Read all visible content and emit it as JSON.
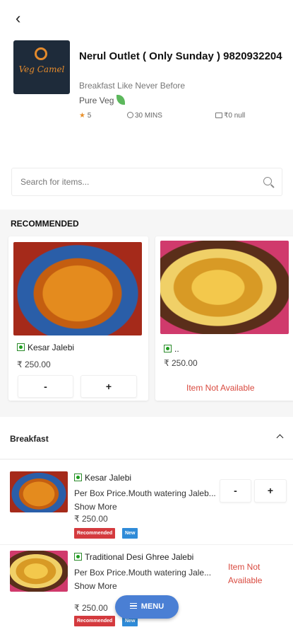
{
  "header": {
    "back_icon": "back-arrow-icon"
  },
  "shop": {
    "logo_text": "Veg Camel",
    "title": "Nerul Outlet ( Only Sunday ) 9820932204",
    "tagline": "Breakfast Like Never Before",
    "pure_veg": "Pure Veg",
    "rating": "5",
    "time": "30 MINS",
    "cost": "₹0 null"
  },
  "search": {
    "placeholder": "Search for items..."
  },
  "recommended": {
    "title": "RECOMMENDED",
    "cards": [
      {
        "name": "Kesar Jalebi",
        "price": "₹ 250.00",
        "minus": "-",
        "plus": "+"
      },
      {
        "name": "..",
        "price": "₹ 250.00",
        "status": "Item Not Available"
      }
    ]
  },
  "section": {
    "title": "Breakfast"
  },
  "items": [
    {
      "name": "Kesar Jalebi",
      "desc": "Per Box Price.Mouth watering Jaleb...",
      "more": "Show More",
      "price": "₹ 250.00",
      "badge_recommended": "Recommended",
      "badge_new": "New",
      "minus": "-",
      "plus": "+"
    },
    {
      "name": "Traditional Desi Ghree Jalebi",
      "desc": "Per Box Price.Mouth watering Jale...",
      "more": "Show More",
      "price": "₹ 250.00",
      "badge_recommended": "Recommended",
      "badge_new": "New",
      "status": "Item Not Available"
    }
  ],
  "fab": {
    "label": "MENU"
  },
  "colors": {
    "accent": "#4a7fd4",
    "unavailable": "#d94a3f",
    "badge_recommended": "#d43a3e",
    "badge_new": "#2f8bd8",
    "rating_star": "#e8912c"
  }
}
